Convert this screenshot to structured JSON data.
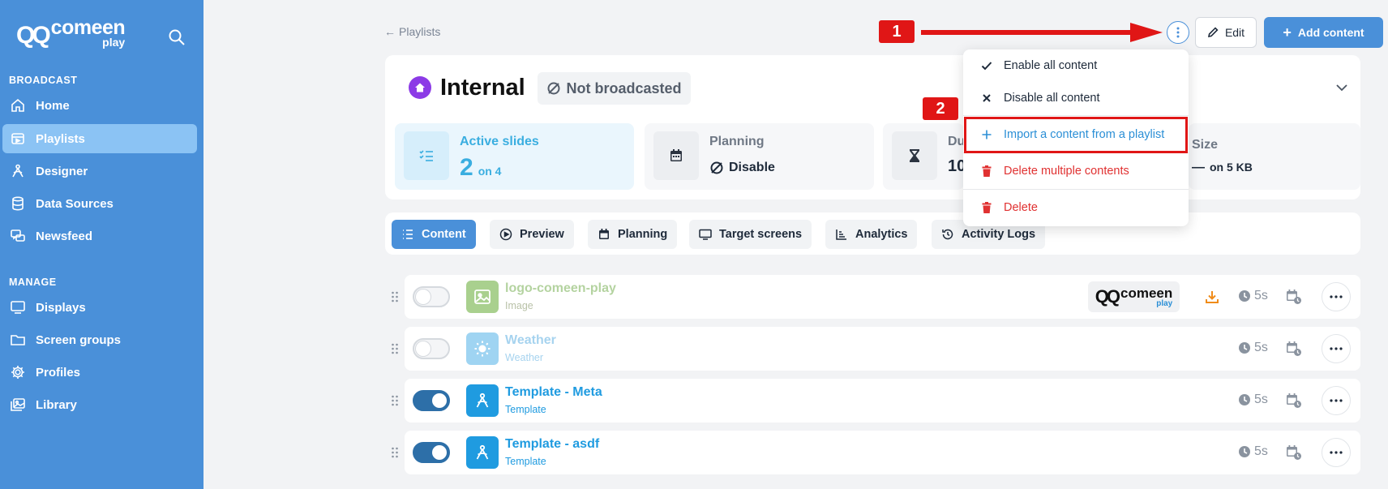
{
  "brand": {
    "mark": "QQ",
    "name": "comeen",
    "sub": "play"
  },
  "sidebar": {
    "sections": [
      {
        "label": "BROADCAST",
        "items": [
          {
            "label": "Home",
            "icon": "home-icon"
          },
          {
            "label": "Playlists",
            "icon": "playlist-icon",
            "active": true
          },
          {
            "label": "Designer",
            "icon": "designer-icon"
          },
          {
            "label": "Data Sources",
            "icon": "database-icon"
          },
          {
            "label": "Newsfeed",
            "icon": "newsfeed-icon"
          }
        ]
      },
      {
        "label": "MANAGE",
        "items": [
          {
            "label": "Displays",
            "icon": "monitor-icon"
          },
          {
            "label": "Screen groups",
            "icon": "folder-icon"
          },
          {
            "label": "Profiles",
            "icon": "gear-icon"
          },
          {
            "label": "Library",
            "icon": "library-icon"
          }
        ]
      }
    ]
  },
  "topbar": {
    "back_label": "Playlists",
    "edit_label": "Edit",
    "add_label": "Add content"
  },
  "annotations": {
    "step1": "1",
    "step2": "2"
  },
  "playlist": {
    "title": "Internal",
    "status": "Not broadcasted",
    "stats": [
      {
        "label": "Active slides",
        "value": "2",
        "suffix": "on 4",
        "icon": "checklist-icon"
      },
      {
        "label": "Planning",
        "value": "Disable",
        "suffix": "",
        "icon": "calendar-icon"
      },
      {
        "label": "Du",
        "value": "10",
        "suffix": "",
        "icon": "hourglass-icon"
      },
      {
        "label": "Size",
        "value": "—",
        "suffix": "on 5 KB",
        "icon": "size-icon"
      }
    ]
  },
  "tabs": [
    {
      "label": "Content",
      "icon": "list-icon",
      "active": true
    },
    {
      "label": "Preview",
      "icon": "play-icon"
    },
    {
      "label": "Planning",
      "icon": "calendar-icon"
    },
    {
      "label": "Target screens",
      "icon": "monitor-icon"
    },
    {
      "label": "Analytics",
      "icon": "chart-icon"
    },
    {
      "label": "Activity Logs",
      "icon": "history-icon"
    }
  ],
  "rows": [
    {
      "title": "logo-comeen-play",
      "type": "Image",
      "enabled": false,
      "duration": "5s"
    },
    {
      "title": "Weather",
      "type": "Weather",
      "enabled": false,
      "duration": "5s"
    },
    {
      "title": "Template - Meta",
      "type": "Template",
      "enabled": true,
      "duration": "5s"
    },
    {
      "title": "Template - asdf",
      "type": "Template",
      "enabled": true,
      "duration": "5s"
    }
  ],
  "dropdown": {
    "items": [
      {
        "label": "Enable all content",
        "icon": "check-icon"
      },
      {
        "label": "Disable all content",
        "icon": "x-icon"
      },
      {
        "label": "Import a content from a playlist",
        "icon": "plus-icon"
      },
      {
        "label": "Delete multiple contents",
        "icon": "trash-icon"
      },
      {
        "label": "Delete",
        "icon": "trash-icon"
      }
    ]
  },
  "colors": {
    "sidebar": "#4a90d9",
    "accent": "#4a90d9",
    "danger": "#e03131",
    "annotation": "#e01616",
    "highlight": "#3aaee0"
  }
}
